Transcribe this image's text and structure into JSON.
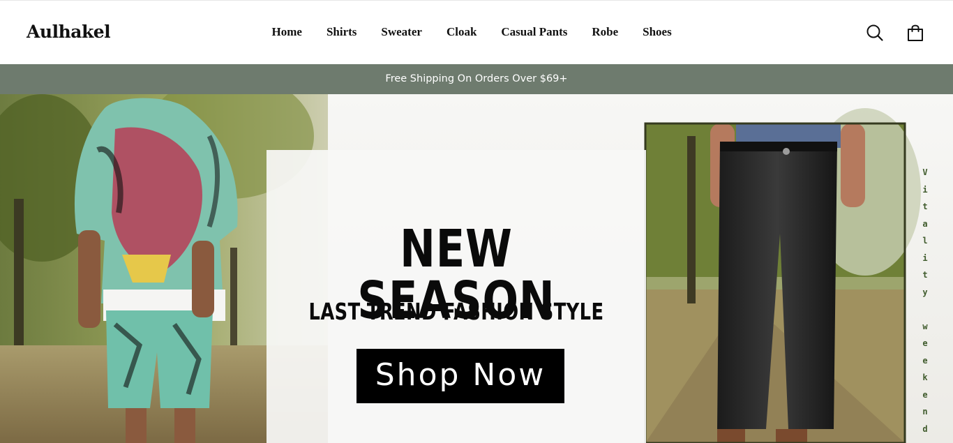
{
  "brand": {
    "logo": "Aulhakel"
  },
  "nav": {
    "items": [
      "Home",
      "Shirts",
      "Sweater",
      "Cloak",
      "Casual Pants",
      "Robe",
      "Shoes"
    ]
  },
  "header_icons": {
    "search": "search-icon",
    "cart": "shopping-bag-icon"
  },
  "announcement": {
    "text": "Free Shipping On Orders Over $69+"
  },
  "hero": {
    "headline": "NEW SEASON",
    "subheadline": "LAST TREND FASHION STYLE",
    "cta_label": "Shop Now",
    "side_text_letters": [
      "V",
      "i",
      "t",
      "a",
      "l",
      "i",
      "t",
      "y",
      "",
      "w",
      "e",
      "e",
      "k",
      "e",
      "n",
      "d"
    ]
  },
  "colors": {
    "announcement_bg": "#6e7b6e",
    "cta_bg": "#000000",
    "side_text": "#3f5b2c"
  }
}
